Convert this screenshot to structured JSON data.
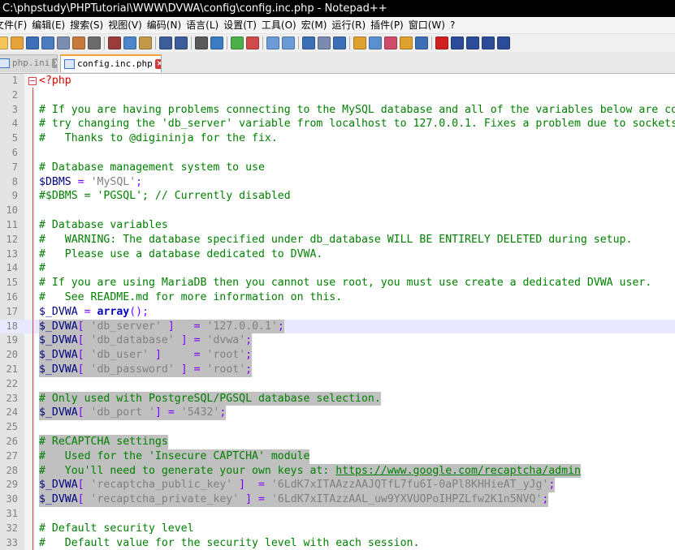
{
  "window": {
    "title": "C:\\phpstudy\\PHPTutorial\\WWW\\DVWA\\config\\config.inc.php - Notepad++"
  },
  "menu": [
    {
      "label": "文件(F)"
    },
    {
      "label": "编辑(E)"
    },
    {
      "label": "搜索(S)"
    },
    {
      "label": "视图(V)"
    },
    {
      "label": "编码(N)"
    },
    {
      "label": "语言(L)"
    },
    {
      "label": "设置(T)"
    },
    {
      "label": "工具(O)"
    },
    {
      "label": "宏(M)"
    },
    {
      "label": "运行(R)"
    },
    {
      "label": "插件(P)"
    },
    {
      "label": "窗口(W)"
    },
    {
      "label": "?"
    }
  ],
  "toolbar": [
    {
      "icon": "new-file-icon",
      "color": "#f4c65a"
    },
    {
      "icon": "open-file-icon",
      "color": "#e8a33a"
    },
    {
      "icon": "save-icon",
      "color": "#3c6fb5"
    },
    {
      "icon": "save-all-icon",
      "color": "#4a7cc2"
    },
    {
      "icon": "close-icon",
      "color": "#7d8db0"
    },
    {
      "icon": "close-all-icon",
      "color": "#c87a3c"
    },
    {
      "icon": "print-icon",
      "color": "#6b6b6b"
    },
    {
      "icon": "cut-icon",
      "color": "#9a3c3c"
    },
    {
      "icon": "copy-icon",
      "color": "#4d86c8"
    },
    {
      "icon": "paste-icon",
      "color": "#c29a4a"
    },
    {
      "icon": "undo-icon",
      "color": "#3c5c9a"
    },
    {
      "icon": "redo-icon",
      "color": "#3c5c9a"
    },
    {
      "icon": "find-icon",
      "color": "#5a5a5a"
    },
    {
      "icon": "replace-icon",
      "color": "#3c7cc2"
    },
    {
      "icon": "zoom-in-icon",
      "color": "#4caf4c"
    },
    {
      "icon": "zoom-out-icon",
      "color": "#d04a4a"
    },
    {
      "icon": "sync-vertical-icon",
      "color": "#6c9ad6"
    },
    {
      "icon": "sync-horizontal-icon",
      "color": "#6c9ad6"
    },
    {
      "icon": "word-wrap-icon",
      "color": "#3c6fb5"
    },
    {
      "icon": "show-all-chars-icon",
      "color": "#7a8ab0"
    },
    {
      "icon": "indent-guide-icon",
      "color": "#3c6fb5"
    },
    {
      "icon": "language-icon",
      "color": "#e0a030"
    },
    {
      "icon": "doc-map-icon",
      "color": "#5a8fd0"
    },
    {
      "icon": "function-list-icon",
      "color": "#d04a6a"
    },
    {
      "icon": "folder-workspace-icon",
      "color": "#e0a030"
    },
    {
      "icon": "monitoring-icon",
      "color": "#3c6fb5"
    },
    {
      "icon": "record-macro-icon",
      "color": "#d02020"
    },
    {
      "icon": "stop-record-icon",
      "color": "#2c4c9a"
    },
    {
      "icon": "playback-icon",
      "color": "#2c4c9a"
    },
    {
      "icon": "run-multiple-icon",
      "color": "#2c4c9a"
    },
    {
      "icon": "save-macro-icon",
      "color": "#2c4c9a"
    }
  ],
  "tabs": [
    {
      "label": "php.ini",
      "active": false
    },
    {
      "label": "config.inc.php",
      "active": true
    }
  ],
  "editor": {
    "current_line": 18,
    "lines": [
      {
        "num": "1",
        "tokens": [
          {
            "t": "php",
            "v": "<?php"
          }
        ]
      },
      {
        "num": "2",
        "tokens": []
      },
      {
        "num": "3",
        "tokens": [
          {
            "t": "cmt",
            "v": "# If you are having problems connecting to the MySQL database and all of the variables below are correct"
          }
        ]
      },
      {
        "num": "4",
        "tokens": [
          {
            "t": "cmt",
            "v": "# try changing the 'db_server' variable from localhost to 127.0.0.1. Fixes a problem due to sockets."
          }
        ]
      },
      {
        "num": "5",
        "tokens": [
          {
            "t": "cmt",
            "v": "#   Thanks to @digininja for the fix."
          }
        ]
      },
      {
        "num": "6",
        "tokens": []
      },
      {
        "num": "7",
        "tokens": [
          {
            "t": "cmt",
            "v": "# Database management system to use"
          }
        ]
      },
      {
        "num": "8",
        "tokens": [
          {
            "t": "var",
            "v": "$DBMS"
          },
          {
            "t": "plain",
            "v": " "
          },
          {
            "t": "op",
            "v": "="
          },
          {
            "t": "plain",
            "v": " "
          },
          {
            "t": "str",
            "v": "'MySQL'"
          },
          {
            "t": "op",
            "v": ";"
          }
        ]
      },
      {
        "num": "9",
        "tokens": [
          {
            "t": "cmt",
            "v": "#$DBMS = 'PGSQL'; // Currently disabled"
          }
        ]
      },
      {
        "num": "10",
        "tokens": []
      },
      {
        "num": "11",
        "tokens": [
          {
            "t": "cmt",
            "v": "# Database variables"
          }
        ]
      },
      {
        "num": "12",
        "tokens": [
          {
            "t": "cmt",
            "v": "#   WARNING: The database specified under db_database WILL BE ENTIRELY DELETED during setup."
          }
        ]
      },
      {
        "num": "13",
        "tokens": [
          {
            "t": "cmt",
            "v": "#   Please use a database dedicated to DVWA."
          }
        ]
      },
      {
        "num": "14",
        "tokens": [
          {
            "t": "cmt",
            "v": "#"
          }
        ]
      },
      {
        "num": "15",
        "tokens": [
          {
            "t": "cmt",
            "v": "# If you are using MariaDB then you cannot use root, you must use create a dedicated DVWA user."
          }
        ]
      },
      {
        "num": "16",
        "tokens": [
          {
            "t": "cmt",
            "v": "#   See README.md for more information on this."
          }
        ]
      },
      {
        "num": "17",
        "tokens": [
          {
            "t": "var",
            "v": "$_DVWA"
          },
          {
            "t": "plain",
            "v": " "
          },
          {
            "t": "op",
            "v": "="
          },
          {
            "t": "plain",
            "v": " "
          },
          {
            "t": "kw",
            "v": "array"
          },
          {
            "t": "op",
            "v": "();"
          }
        ]
      },
      {
        "num": "18",
        "sel": true,
        "tokens": [
          {
            "t": "var",
            "v": "$_DVWA"
          },
          {
            "t": "op",
            "v": "["
          },
          {
            "t": "plain",
            "v": " "
          },
          {
            "t": "str",
            "v": "'db_server'"
          },
          {
            "t": "plain",
            "v": " "
          },
          {
            "t": "op",
            "v": "]"
          },
          {
            "t": "plain",
            "v": "   "
          },
          {
            "t": "op",
            "v": "="
          },
          {
            "t": "plain",
            "v": " "
          },
          {
            "t": "str",
            "v": "'127.0.0.1'"
          },
          {
            "t": "op",
            "v": ";"
          }
        ]
      },
      {
        "num": "19",
        "sel": true,
        "tokens": [
          {
            "t": "var",
            "v": "$_DVWA"
          },
          {
            "t": "op",
            "v": "["
          },
          {
            "t": "plain",
            "v": " "
          },
          {
            "t": "str",
            "v": "'db_database'"
          },
          {
            "t": "plain",
            "v": " "
          },
          {
            "t": "op",
            "v": "]"
          },
          {
            "t": "plain",
            "v": " "
          },
          {
            "t": "op",
            "v": "="
          },
          {
            "t": "plain",
            "v": " "
          },
          {
            "t": "str",
            "v": "'dvwa'"
          },
          {
            "t": "op",
            "v": ";"
          }
        ]
      },
      {
        "num": "20",
        "sel": true,
        "tokens": [
          {
            "t": "var",
            "v": "$_DVWA"
          },
          {
            "t": "op",
            "v": "["
          },
          {
            "t": "plain",
            "v": " "
          },
          {
            "t": "str",
            "v": "'db_user'"
          },
          {
            "t": "plain",
            "v": " "
          },
          {
            "t": "op",
            "v": "]"
          },
          {
            "t": "plain",
            "v": "     "
          },
          {
            "t": "op",
            "v": "="
          },
          {
            "t": "plain",
            "v": " "
          },
          {
            "t": "str",
            "v": "'root'"
          },
          {
            "t": "op",
            "v": ";"
          }
        ]
      },
      {
        "num": "21",
        "sel": true,
        "tokens": [
          {
            "t": "var",
            "v": "$_DVWA"
          },
          {
            "t": "op",
            "v": "["
          },
          {
            "t": "plain",
            "v": " "
          },
          {
            "t": "str",
            "v": "'db_password'"
          },
          {
            "t": "plain",
            "v": " "
          },
          {
            "t": "op",
            "v": "]"
          },
          {
            "t": "plain",
            "v": " "
          },
          {
            "t": "op",
            "v": "="
          },
          {
            "t": "plain",
            "v": " "
          },
          {
            "t": "str",
            "v": "'root'"
          },
          {
            "t": "op",
            "v": ";"
          }
        ]
      },
      {
        "num": "22",
        "sel": true,
        "tokens": []
      },
      {
        "num": "23",
        "sel": true,
        "tokens": [
          {
            "t": "cmt",
            "v": "# Only used with PostgreSQL/PGSQL database selection."
          }
        ]
      },
      {
        "num": "24",
        "sel": true,
        "tokens": [
          {
            "t": "var",
            "v": "$_DVWA"
          },
          {
            "t": "op",
            "v": "["
          },
          {
            "t": "plain",
            "v": " "
          },
          {
            "t": "str",
            "v": "'db_port '"
          },
          {
            "t": "op",
            "v": "]"
          },
          {
            "t": "plain",
            "v": " "
          },
          {
            "t": "op",
            "v": "="
          },
          {
            "t": "plain",
            "v": " "
          },
          {
            "t": "str",
            "v": "'5432'"
          },
          {
            "t": "op",
            "v": ";"
          }
        ]
      },
      {
        "num": "25",
        "sel": true,
        "tokens": []
      },
      {
        "num": "26",
        "sel": true,
        "tokens": [
          {
            "t": "cmt",
            "v": "# ReCAPTCHA settings"
          }
        ]
      },
      {
        "num": "27",
        "sel": true,
        "tokens": [
          {
            "t": "cmt",
            "v": "#   Used for the 'Insecure CAPTCHA' module"
          }
        ]
      },
      {
        "num": "28",
        "sel": true,
        "tokens": [
          {
            "t": "cmt",
            "v": "#   You'll need to generate your own keys at: "
          },
          {
            "t": "url",
            "v": "https://www.google.com/recaptcha/admin"
          }
        ]
      },
      {
        "num": "29",
        "sel": true,
        "tokens": [
          {
            "t": "var",
            "v": "$_DVWA"
          },
          {
            "t": "op",
            "v": "["
          },
          {
            "t": "plain",
            "v": " "
          },
          {
            "t": "str",
            "v": "'recaptcha_public_key'"
          },
          {
            "t": "plain",
            "v": " "
          },
          {
            "t": "op",
            "v": "]"
          },
          {
            "t": "plain",
            "v": "  "
          },
          {
            "t": "op",
            "v": "="
          },
          {
            "t": "plain",
            "v": " "
          },
          {
            "t": "str",
            "v": "'6LdK7xITAAzzAAJQTfL7fu6I-0aPl8KHHieAT_yJg'"
          },
          {
            "t": "op",
            "v": ";"
          }
        ]
      },
      {
        "num": "30",
        "sel": true,
        "tokens": [
          {
            "t": "var",
            "v": "$_DVWA"
          },
          {
            "t": "op",
            "v": "["
          },
          {
            "t": "plain",
            "v": " "
          },
          {
            "t": "str",
            "v": "'recaptcha_private_key'"
          },
          {
            "t": "plain",
            "v": " "
          },
          {
            "t": "op",
            "v": "]"
          },
          {
            "t": "plain",
            "v": " "
          },
          {
            "t": "op",
            "v": "="
          },
          {
            "t": "plain",
            "v": " "
          },
          {
            "t": "str",
            "v": "'6LdK7xITAzzAAL_uw9YXVUOPoIHPZLfw2K1n5NVQ'"
          },
          {
            "t": "op",
            "v": ";"
          }
        ]
      },
      {
        "num": "31",
        "tokens": []
      },
      {
        "num": "32",
        "tokens": [
          {
            "t": "cmt",
            "v": "# Default security level"
          }
        ]
      },
      {
        "num": "33",
        "tokens": [
          {
            "t": "cmt",
            "v": "#   Default value for the security level with each session."
          }
        ]
      }
    ]
  }
}
